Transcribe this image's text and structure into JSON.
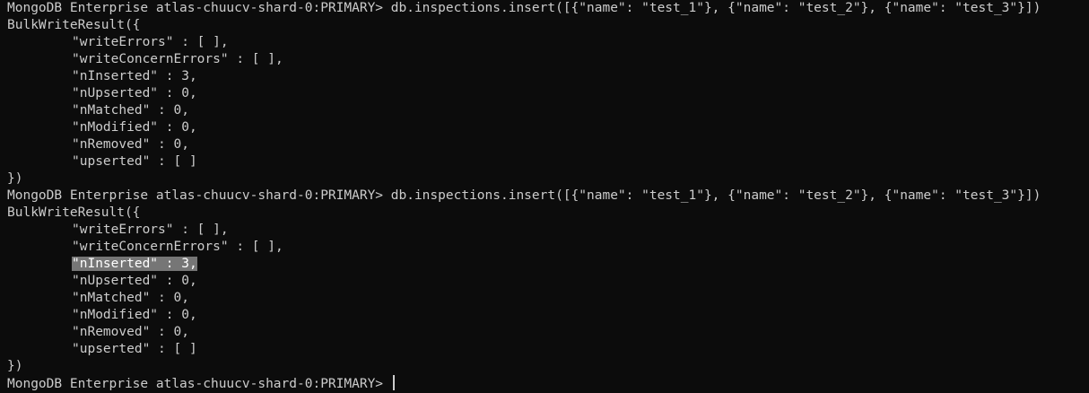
{
  "terminal": {
    "prompt": "MongoDB Enterprise atlas-chuucv-shard-0:PRIMARY> ",
    "blocks": [
      {
        "command": "db.inspections.insert([{\"name\": \"test_1\"}, {\"name\": \"test_2\"}, {\"name\": \"test_3\"}])",
        "result_open": "BulkWriteResult({",
        "fields": [
          "\"writeErrors\" : [ ],",
          "\"writeConcernErrors\" : [ ],",
          "\"nInserted\" : 3,",
          "\"nUpserted\" : 0,",
          "\"nMatched\" : 0,",
          "\"nModified\" : 0,",
          "\"nRemoved\" : 0,",
          "\"upserted\" : [ ]"
        ],
        "result_close": "})"
      },
      {
        "command": "db.inspections.insert([{\"name\": \"test_1\"}, {\"name\": \"test_2\"}, {\"name\": \"test_3\"}])",
        "result_open": "BulkWriteResult({",
        "fields": [
          "\"writeErrors\" : [ ],",
          "\"writeConcernErrors\" : [ ],",
          "\"nInserted\" : 3,",
          "\"nUpserted\" : 0,",
          "\"nMatched\" : 0,",
          "\"nModified\" : 0,",
          "\"nRemoved\" : 0,",
          "\"upserted\" : [ ]"
        ],
        "result_close": "})"
      }
    ],
    "final_prompt": "MongoDB Enterprise atlas-chuucv-shard-0:PRIMARY> ",
    "colors": {
      "background": "#0c0c0c",
      "foreground": "#cccccc",
      "selection": "#767676"
    }
  }
}
